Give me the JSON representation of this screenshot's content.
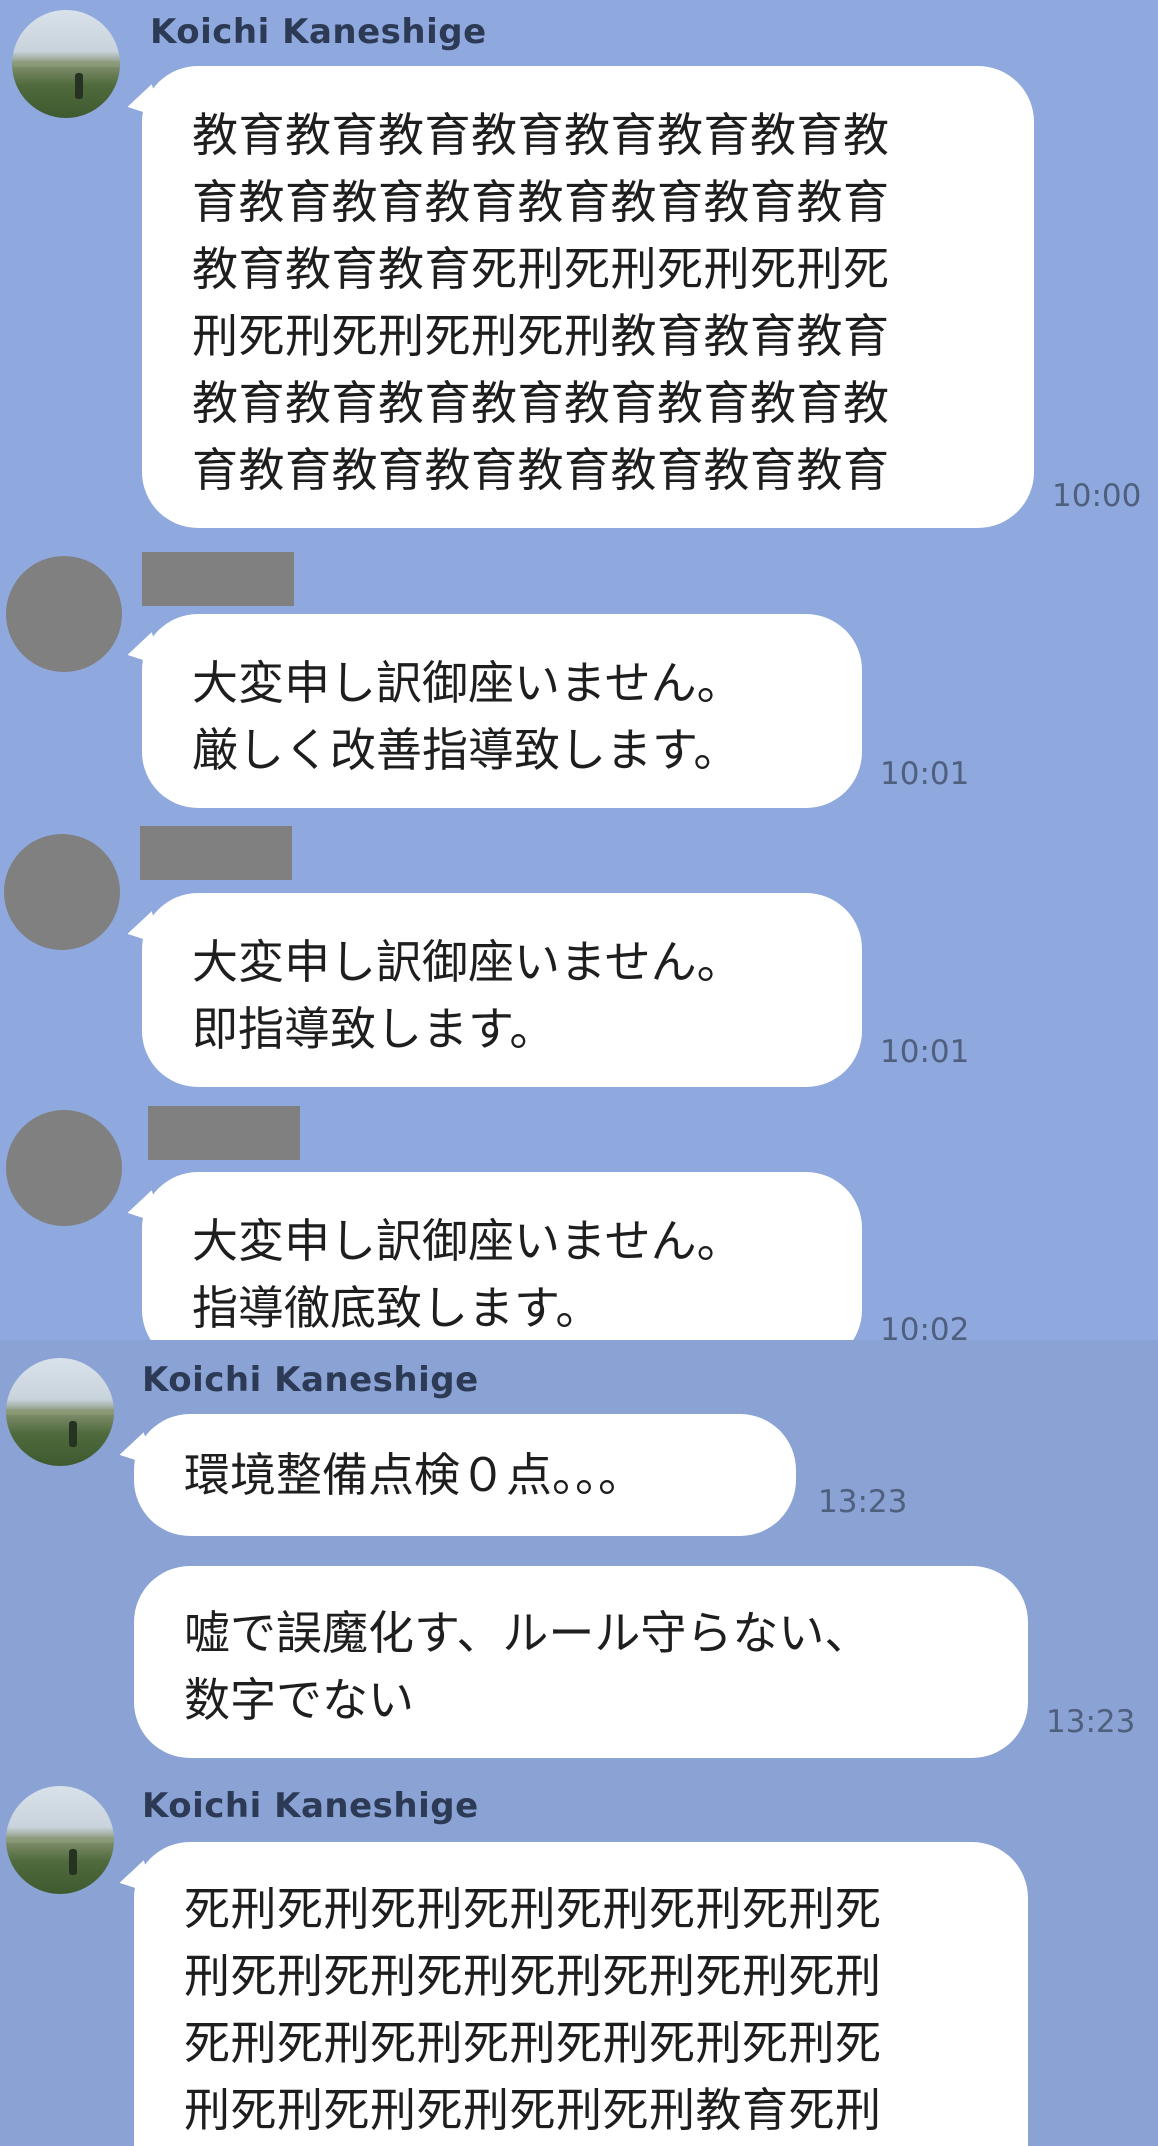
{
  "panel_top": {
    "msg1": {
      "sender": "Koichi Kaneshige",
      "avatar_icon": "profile-photo-icon",
      "text": "教育教育教育教育教育教育教育教\n育教育教育教育教育教育教育教育\n教育教育教育死刑死刑死刑死刑死\n刑死刑死刑死刑死刑教育教育教育\n教育教育教育教育教育教育教育教\n育教育教育教育教育教育教育教育",
      "time": "10:00"
    },
    "msg2": {
      "avatar_icon": "redacted-avatar-icon",
      "text": "大変申し訳御座いません。\n厳しく改善指導致します。",
      "time": "10:01"
    },
    "msg3": {
      "avatar_icon": "redacted-avatar-icon",
      "text": "大変申し訳御座いません。\n即指導致します。",
      "time": "10:01"
    },
    "msg4": {
      "avatar_icon": "redacted-avatar-icon",
      "text": "大変申し訳御座いません。\n指導徹底致します。",
      "time": "10:02"
    }
  },
  "panel_bottom": {
    "msg5": {
      "sender": "Koichi Kaneshige",
      "avatar_icon": "profile-photo-icon",
      "text": "環境整備点検０点。。。",
      "time": "13:23"
    },
    "msg6": {
      "text": "嘘で誤魔化す、ルール守らない、\n数字でない",
      "time": "13:23"
    },
    "msg7": {
      "sender": "Koichi Kaneshige",
      "avatar_icon": "profile-photo-icon",
      "text": "死刑死刑死刑死刑死刑死刑死刑死\n刑死刑死刑死刑死刑死刑死刑死刑\n死刑死刑死刑死刑死刑死刑死刑死\n刑死刑死刑死刑死刑死刑教育死刑"
    }
  },
  "colors": {
    "background_top": "#8fa9de",
    "background_bottom": "#8aa3d4",
    "bubble": "#ffffff",
    "redaction": "#808080"
  }
}
